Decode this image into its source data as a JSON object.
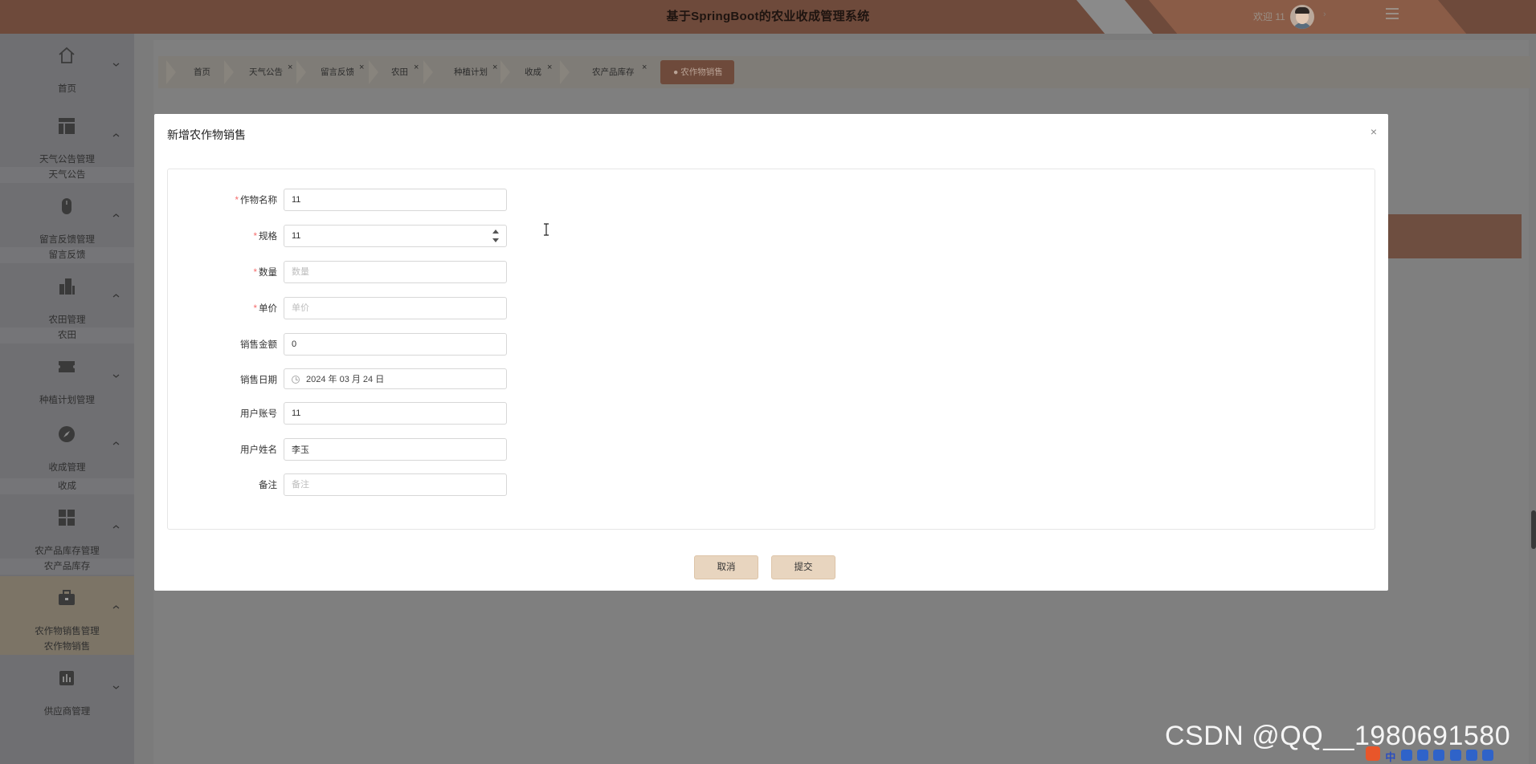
{
  "header": {
    "title": "基于SpringBoot的农业收成管理系统",
    "welcome": "欢迎 11"
  },
  "sidebar": {
    "groups": [
      {
        "label": "首页",
        "icon": "home-icon",
        "sub": null
      },
      {
        "label": "天气公告管理",
        "icon": "layout-icon",
        "sub": "天气公告"
      },
      {
        "label": "留言反馈管理",
        "icon": "mouse-icon",
        "sub": "留言反馈"
      },
      {
        "label": "农田管理",
        "icon": "building-icon",
        "sub": "农田"
      },
      {
        "label": "种植计划管理",
        "icon": "ticket-icon",
        "sub": null
      },
      {
        "label": "收成管理",
        "icon": "compass-icon",
        "sub": "收成"
      },
      {
        "label": "农产品库存管理",
        "icon": "grid-icon",
        "sub": "农产品库存"
      },
      {
        "label": "农作物销售管理",
        "icon": "briefcase-icon",
        "sub": "农作物销售"
      },
      {
        "label": "供应商管理",
        "icon": "chart-icon",
        "sub": null
      }
    ]
  },
  "tabs": [
    {
      "label": "首页",
      "closable": false
    },
    {
      "label": "天气公告",
      "closable": true
    },
    {
      "label": "留言反馈",
      "closable": true
    },
    {
      "label": "农田",
      "closable": true
    },
    {
      "label": "种植计划",
      "closable": true
    },
    {
      "label": "收成",
      "closable": true
    },
    {
      "label": "农产品库存",
      "closable": true
    },
    {
      "label": "● 农作物销售",
      "closable": false,
      "active": true
    }
  ],
  "modal": {
    "title": "新增农作物销售",
    "fields": [
      {
        "label": "作物名称",
        "required": true,
        "value": "11",
        "placeholder": "作物名称"
      },
      {
        "label": "规格",
        "required": true,
        "value": "11",
        "placeholder": "规格"
      },
      {
        "label": "数量",
        "required": true,
        "value": "",
        "placeholder": "数量"
      },
      {
        "label": "单价",
        "required": true,
        "value": "",
        "placeholder": "单价"
      },
      {
        "label": "销售金额",
        "required": false,
        "value": "0",
        "placeholder": "销售金额"
      },
      {
        "label": "销售日期",
        "required": false,
        "value": "2024 年 03 月 24 日",
        "placeholder": ""
      },
      {
        "label": "用户账号",
        "required": false,
        "value": "11",
        "placeholder": "用户账号"
      },
      {
        "label": "用户姓名",
        "required": false,
        "value": "李玉",
        "placeholder": "用户姓名"
      },
      {
        "label": "备注",
        "required": false,
        "value": "",
        "placeholder": "备注"
      }
    ],
    "cancel_label": "取消",
    "submit_label": "提交"
  },
  "watermark": "CSDN @QQ__1980691580",
  "tray": {
    "ime": "中"
  },
  "colors": {
    "brand": "#6e4a3b",
    "button": "#e8d5bf",
    "required": "#f56c6c"
  }
}
